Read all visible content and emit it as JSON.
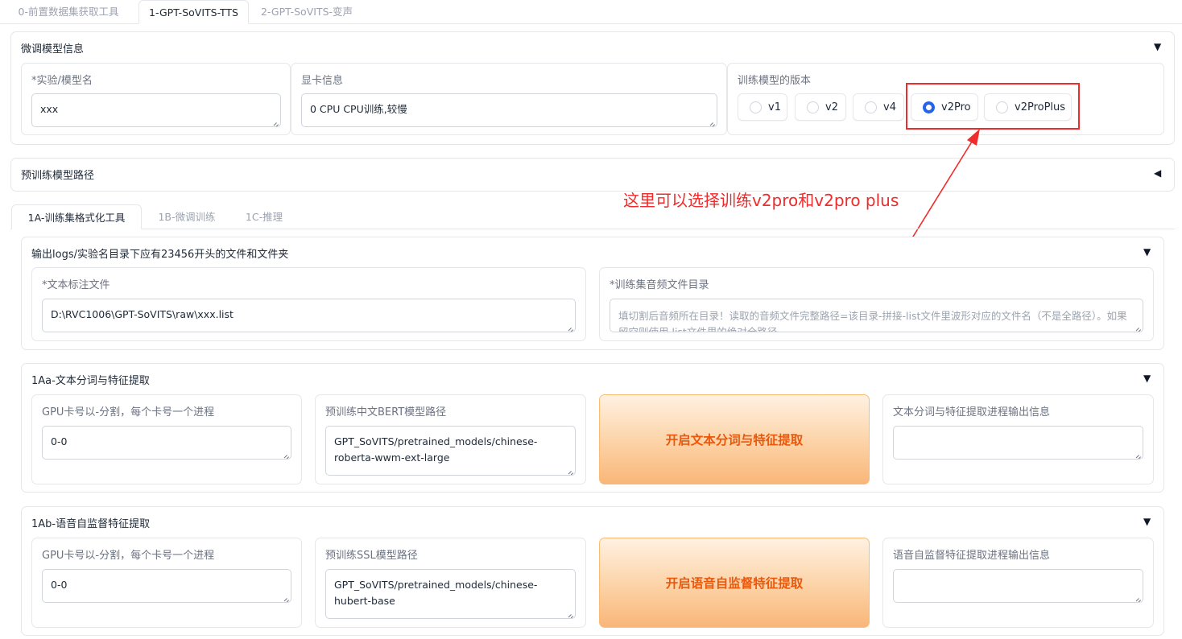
{
  "top_tabs": [
    {
      "label": "0-前置数据集获取工具"
    },
    {
      "label": "1-GPT-SoVITS-TTS"
    },
    {
      "label": "2-GPT-SoVITS-变声"
    }
  ],
  "finetune_panel": {
    "title": "微调模型信息",
    "caret": "▼",
    "exp_name": {
      "label": "*实验/模型名",
      "value": "xxx"
    },
    "gpu_info": {
      "label": "显卡信息",
      "value": "0 CPU CPU训练,较慢"
    },
    "version": {
      "label": "训练模型的版本",
      "options": [
        {
          "label": "v1",
          "checked": false
        },
        {
          "label": "v2",
          "checked": false
        },
        {
          "label": "v4",
          "checked": false
        },
        {
          "label": "v2Pro",
          "checked": true
        },
        {
          "label": "v2ProPlus",
          "checked": false
        }
      ]
    }
  },
  "pretrained_panel": {
    "title": "预训练模型路径",
    "caret": "◀"
  },
  "annotation": {
    "text": "这里可以选择训练v2pro和v2pro plus",
    "color": "#ef2b2b"
  },
  "sub_tabs": [
    {
      "label": "1A-训练集格式化工具"
    },
    {
      "label": "1B-微调训练"
    },
    {
      "label": "1C-推理"
    }
  ],
  "output_panel": {
    "title": "输出logs/实验名目录下应有23456开头的文件和文件夹",
    "caret": "▼",
    "text_label_file": {
      "label": "*文本标注文件",
      "value": "D:\\RVC1006\\GPT-SoVITS\\raw\\xxx.list"
    },
    "audio_dir": {
      "label": "*训练集音频文件目录",
      "placeholder": "填切割后音频所在目录！读取的音频文件完整路径=该目录-拼接-list文件里波形对应的文件名（不是全路径）。如果留空则使用.list文件里的绝对全路径。"
    }
  },
  "panel_1aa": {
    "title": "1Aa-文本分词与特征提取",
    "caret": "▼",
    "gpu": {
      "label": "GPU卡号以-分割，每个卡号一个进程",
      "value": "0-0"
    },
    "bert": {
      "label": "预训练中文BERT模型路径",
      "value": "GPT_SoVITS/pretrained_models/chinese-roberta-wwm-ext-large"
    },
    "button": "开启文本分词与特征提取",
    "output": {
      "label": "文本分词与特征提取进程输出信息",
      "value": ""
    }
  },
  "panel_1ab": {
    "title": "1Ab-语音自监督特征提取",
    "caret": "▼",
    "gpu": {
      "label": "GPU卡号以-分割，每个卡号一个进程",
      "value": "0-0"
    },
    "ssl": {
      "label": "预训练SSL模型路径",
      "value": "GPT_SoVITS/pretrained_models/chinese-hubert-base"
    },
    "button": "开启语音自监督特征提取",
    "output": {
      "label": "语音自监督特征提取进程输出信息",
      "value": ""
    }
  }
}
